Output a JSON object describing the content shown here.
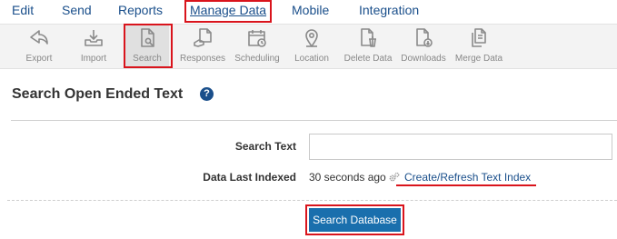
{
  "menu": [
    {
      "label": "Edit",
      "active": false
    },
    {
      "label": "Send",
      "active": false
    },
    {
      "label": "Reports",
      "active": false
    },
    {
      "label": "Manage Data",
      "active": true
    },
    {
      "label": "Mobile",
      "active": false
    },
    {
      "label": "Integration",
      "active": false
    }
  ],
  "toolbar": [
    {
      "label": "Export",
      "icon": "export-icon"
    },
    {
      "label": "Import",
      "icon": "import-icon"
    },
    {
      "label": "Search",
      "icon": "search-document-icon",
      "selected": true
    },
    {
      "label": "Responses",
      "icon": "responses-icon"
    },
    {
      "label": "Scheduling",
      "icon": "calendar-icon"
    },
    {
      "label": "Location",
      "icon": "location-pin-icon"
    },
    {
      "label": "Delete Data",
      "icon": "delete-document-icon"
    },
    {
      "label": "Downloads",
      "icon": "download-document-icon"
    },
    {
      "label": "Merge Data",
      "icon": "merge-documents-icon"
    }
  ],
  "page": {
    "title": "Search Open Ended Text",
    "help_glyph": "?"
  },
  "form": {
    "search_text_label": "Search Text",
    "search_text_value": "",
    "indexed_label": "Data Last Indexed",
    "indexed_value": "30 seconds ago",
    "refresh_link": "Create/Refresh Text Index",
    "submit_label": "Search Database"
  },
  "colors": {
    "accent": "#1a4f8b",
    "button": "#1a6fad",
    "highlight": "#d9141c"
  }
}
